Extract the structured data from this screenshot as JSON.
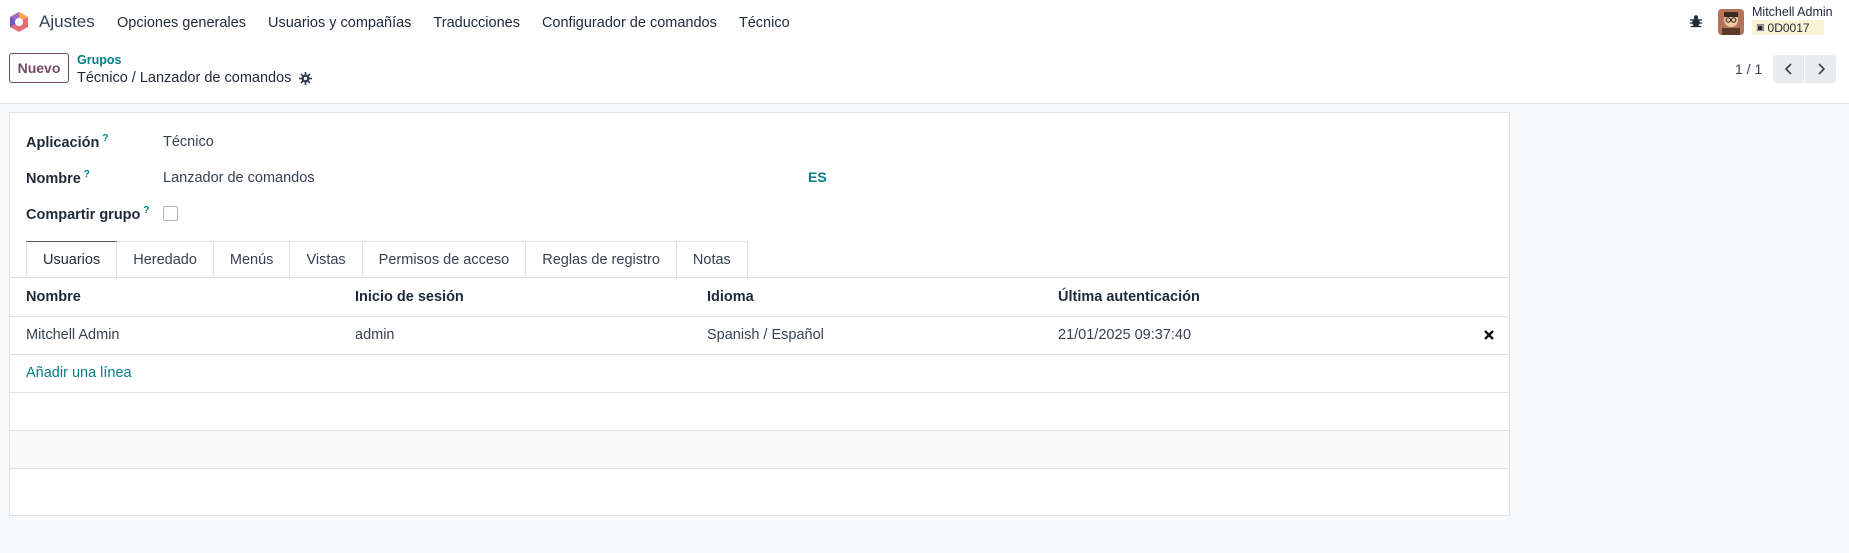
{
  "navbar": {
    "app_name": "Ajustes",
    "menu": [
      "Opciones generales",
      "Usuarios y compañías",
      "Traducciones",
      "Configurador de comandos",
      "Técnico"
    ],
    "user_name": "Mitchell Admin",
    "database": "0D0017",
    "icons": {
      "logo": "odoo-logo-icon",
      "debug": "bug-icon",
      "db": "database-icon"
    }
  },
  "control": {
    "new_button": "Nuevo",
    "breadcrumb_parent": "Grupos",
    "breadcrumb_current": "Técnico / Lanzador de comandos",
    "pager": "1 / 1"
  },
  "form": {
    "fields": {
      "application_label": "Aplicación",
      "application_value": "Técnico",
      "name_label": "Nombre",
      "name_value": "Lanzador de comandos",
      "name_lang": "ES",
      "share_label": "Compartir grupo",
      "share_checked": false,
      "help_mark": "?"
    },
    "tabs": [
      "Usuarios",
      "Heredado",
      "Menús",
      "Vistas",
      "Permisos de acceso",
      "Reglas de registro",
      "Notas"
    ],
    "active_tab": "Usuarios",
    "table": {
      "columns": [
        "Nombre",
        "Inicio de sesión",
        "Idioma",
        "Última autenticación"
      ],
      "rows": [
        [
          "Mitchell Admin",
          "admin",
          "Spanish / Español",
          "21/01/2025 09:37:40"
        ]
      ],
      "add_line": "Añadir una línea"
    }
  },
  "colors": {
    "brand": "#714b67",
    "link": "#017e84",
    "background": "#f8f9fa"
  }
}
